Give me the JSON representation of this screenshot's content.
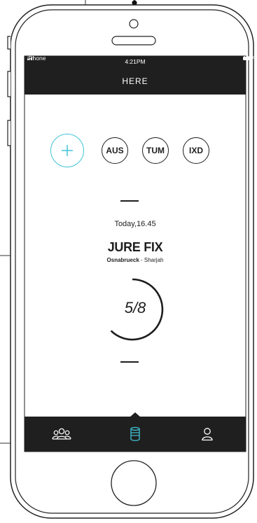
{
  "status_bar": {
    "carrier": "iPhone",
    "time": "4:21PM",
    "battery": "100%"
  },
  "nav": {
    "title": "HERE"
  },
  "chips": [
    "AUS",
    "TUM",
    "IXD"
  ],
  "event": {
    "date": "Today,16.45",
    "name": "JURE FIX",
    "origin": "Osnabrueck",
    "separator": " - ",
    "destination": "Sharjah"
  },
  "progress": {
    "label": "5/8",
    "current": 5,
    "total": 8
  },
  "colors": {
    "accent": "#3fc4d6",
    "bar": "#1f1f1f",
    "ink": "#1e1e1e"
  },
  "tabs": [
    {
      "icon": "group-icon"
    },
    {
      "icon": "cup-icon",
      "active": true
    },
    {
      "icon": "person-icon"
    }
  ]
}
